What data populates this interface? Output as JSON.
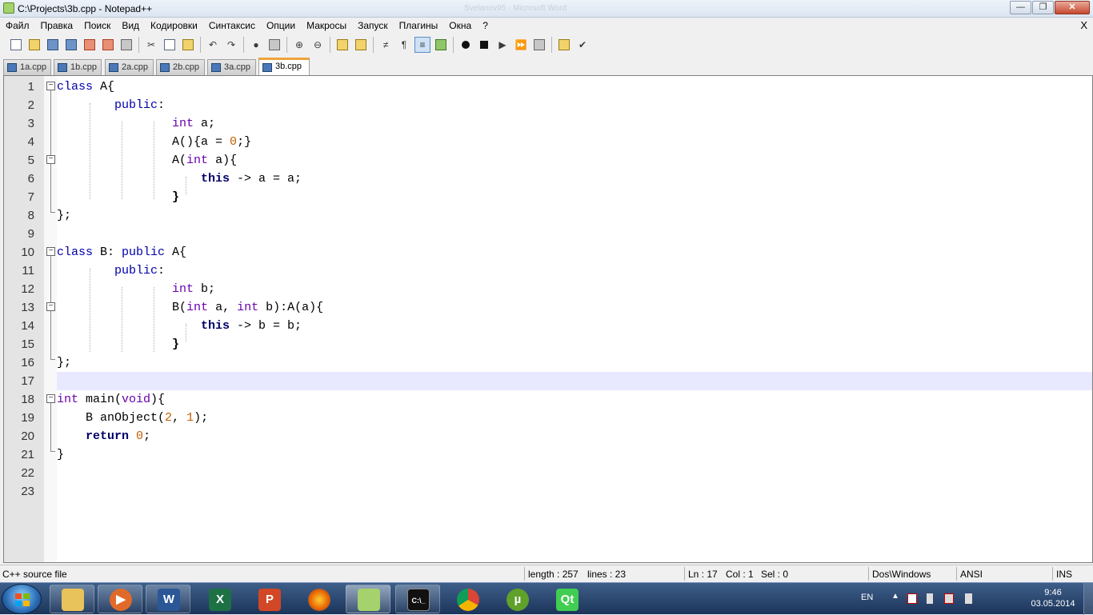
{
  "window": {
    "title": "C:\\Projects\\3b.cpp - Notepad++",
    "ghost_title": "Svelanov95 - Microsoft Word",
    "close_x": "X"
  },
  "menu": [
    "Файл",
    "Правка",
    "Поиск",
    "Вид",
    "Кодировки",
    "Синтаксис",
    "Опции",
    "Макросы",
    "Запуск",
    "Плагины",
    "Окна",
    "?"
  ],
  "tabs": [
    "1a.cpp",
    "1b.cpp",
    "2a.cpp",
    "2b.cpp",
    "3a.cpp",
    "3b.cpp"
  ],
  "active_tab": "3b.cpp",
  "editor": {
    "line_numbers": [
      "1",
      "2",
      "3",
      "4",
      "5",
      "6",
      "7",
      "8",
      "9",
      "10",
      "11",
      "12",
      "13",
      "14",
      "15",
      "16",
      "17",
      "18",
      "19",
      "20",
      "21",
      "22",
      "23"
    ],
    "current_line": 17
  },
  "code": {
    "l1": {
      "a": "class",
      "b": " A{"
    },
    "l2": {
      "a": "public",
      "b": ":"
    },
    "l3": {
      "a": "int",
      "b": " a;"
    },
    "l4": {
      "a": "A(){a = ",
      "n": "0",
      "b": ";}"
    },
    "l5": {
      "a": "A(",
      "t": "int",
      "b": " a){"
    },
    "l6": {
      "k": "this",
      "b": " -> a = a;"
    },
    "l7": {
      "b": "}"
    },
    "l8": {
      "b": "};"
    },
    "l10": {
      "a": "class",
      "b": " B: ",
      "c": "public",
      "d": " A{"
    },
    "l11": {
      "a": "public",
      "b": ":"
    },
    "l12": {
      "a": "int",
      "b": " b;"
    },
    "l13": {
      "a": "B(",
      "t": "int",
      "b": " a, ",
      "t2": "int",
      "c": " b):A(a){"
    },
    "l14": {
      "k": "this",
      "b": " -> b = b;"
    },
    "l15": {
      "b": "}"
    },
    "l16": {
      "b": "};"
    },
    "l18": {
      "a": "int",
      "b": " main(",
      "c": "void",
      "d": "){"
    },
    "l19": {
      "a": "B anObject(",
      "n1": "2",
      "b": ", ",
      "n2": "1",
      "c": ");"
    },
    "l20": {
      "k": "return",
      "b": " ",
      "n": "0",
      "c": ";"
    },
    "l21": {
      "b": "}"
    }
  },
  "status": {
    "file_type": "C++ source file",
    "length": "length : 257",
    "lines": "lines : 23",
    "ln": "Ln : 17",
    "col": "Col : 1",
    "sel": "Sel : 0",
    "eol": "Dos\\Windows",
    "encoding": "ANSI",
    "mode": "INS"
  },
  "taskbar": {
    "apps": [
      "Windows Explorer",
      "Windows Media Player",
      "Microsoft Word",
      "Microsoft Excel",
      "Microsoft PowerPoint",
      "Firefox",
      "Notepad++",
      "Command Prompt",
      "Google Chrome",
      "uTorrent",
      "Qt Creator"
    ],
    "app_letters": {
      "word": "W",
      "excel": "X",
      "ppt": "P",
      "qt": "Qt",
      "cmd": "C:\\_"
    },
    "language": "EN",
    "time": "9:46",
    "date": "03.05.2014"
  },
  "colors": {
    "keyword": "#0000aa",
    "type": "#6a00b0",
    "number": "#c06000",
    "current_line": "#e8e8ff",
    "active_tab_accent": "#f0a33a"
  }
}
